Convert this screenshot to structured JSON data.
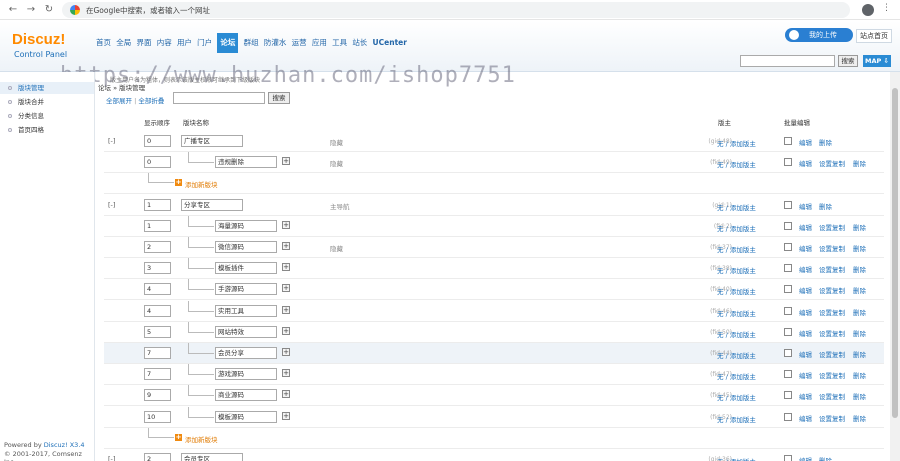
{
  "browser": {
    "url_placeholder": "在Google中搜索，或者输入一个网址"
  },
  "header": {
    "logo": "Discuz!",
    "logo_sub": "Control Panel",
    "nav": [
      "首页",
      "全局",
      "界面",
      "内容",
      "用户",
      "门户",
      "论坛",
      "群组",
      "防灌水",
      "运营",
      "应用",
      "工具",
      "站长",
      "UCenter"
    ],
    "active_nav": "论坛",
    "cloud_label": "我的上传",
    "home_label": "站点首页",
    "search_btn": "搜索",
    "map_btn": "MAP ⇩",
    "breadcrumb": "论坛 » 版块管理",
    "watermark": "https://www.huzhan.com/ishop7751"
  },
  "sidebar": {
    "items": [
      "版块管理",
      "版块合并",
      "分类信息",
      "首页四格"
    ],
    "powered_prefix": "Powered by ",
    "powered_brand": "Discuz! X3.4",
    "copyright": "© 2001-2017, Comsenz Inc."
  },
  "main": {
    "tip": "版主用户名为粗体，则表示该版主权限可继承到下级版块",
    "expand_all": "全部展开",
    "separator": "|",
    "collapse_all": "全部折叠",
    "search_btn": "搜索",
    "headers": {
      "order": "显示顺序",
      "name": "版块名称",
      "moderator": "版主",
      "batch": "批量编辑"
    },
    "add_subforum": "添加新版块",
    "mod_text": "无 / 添加版主",
    "actions": {
      "edit": "编辑",
      "copy": "设置复制",
      "delete": "删除"
    },
    "rows": [
      {
        "type": "group",
        "toggle": "[-]",
        "order": "0",
        "name": "广播专区",
        "note": "隐藏",
        "fid": "(gid:48)"
      },
      {
        "type": "forum",
        "order": "0",
        "name": "违规删除",
        "note": "隐藏",
        "fid": "(fid:49)"
      },
      {
        "type": "add"
      },
      {
        "type": "group",
        "toggle": "[-]",
        "order": "1",
        "name": "分享专区",
        "note": "主导航",
        "fid": "(gid:1)"
      },
      {
        "type": "forum",
        "order": "1",
        "name": "海量源码",
        "note": "",
        "fid": "(fid:2)"
      },
      {
        "type": "forum",
        "order": "2",
        "name": "微信源码",
        "note": "隐藏",
        "fid": "(fid:37)"
      },
      {
        "type": "forum",
        "order": "3",
        "name": "模板插件",
        "note": "",
        "fid": "(fid:38)"
      },
      {
        "type": "forum",
        "order": "4",
        "name": "手游源码",
        "note": "",
        "fid": "(fid:40)"
      },
      {
        "type": "forum",
        "order": "4",
        "name": "实用工具",
        "note": "",
        "fid": "(fid:46)"
      },
      {
        "type": "forum",
        "order": "5",
        "name": "网站特效",
        "note": "",
        "fid": "(fid:50)"
      },
      {
        "type": "forum",
        "order": "7",
        "name": "会员分享",
        "note": "",
        "fid": "(fid:44)",
        "highlight": true
      },
      {
        "type": "forum",
        "order": "7",
        "name": "游戏源码",
        "note": "",
        "fid": "(fid:47)"
      },
      {
        "type": "forum",
        "order": "9",
        "name": "商业源码",
        "note": "",
        "fid": "(fid:45)"
      },
      {
        "type": "forum",
        "order": "10",
        "name": "模板源码",
        "note": "",
        "fid": "(fid:52)"
      },
      {
        "type": "add"
      },
      {
        "type": "group",
        "toggle": "[-]",
        "order": "2",
        "name": "会员专区",
        "note": "",
        "fid": "(gid:36)"
      }
    ]
  }
}
